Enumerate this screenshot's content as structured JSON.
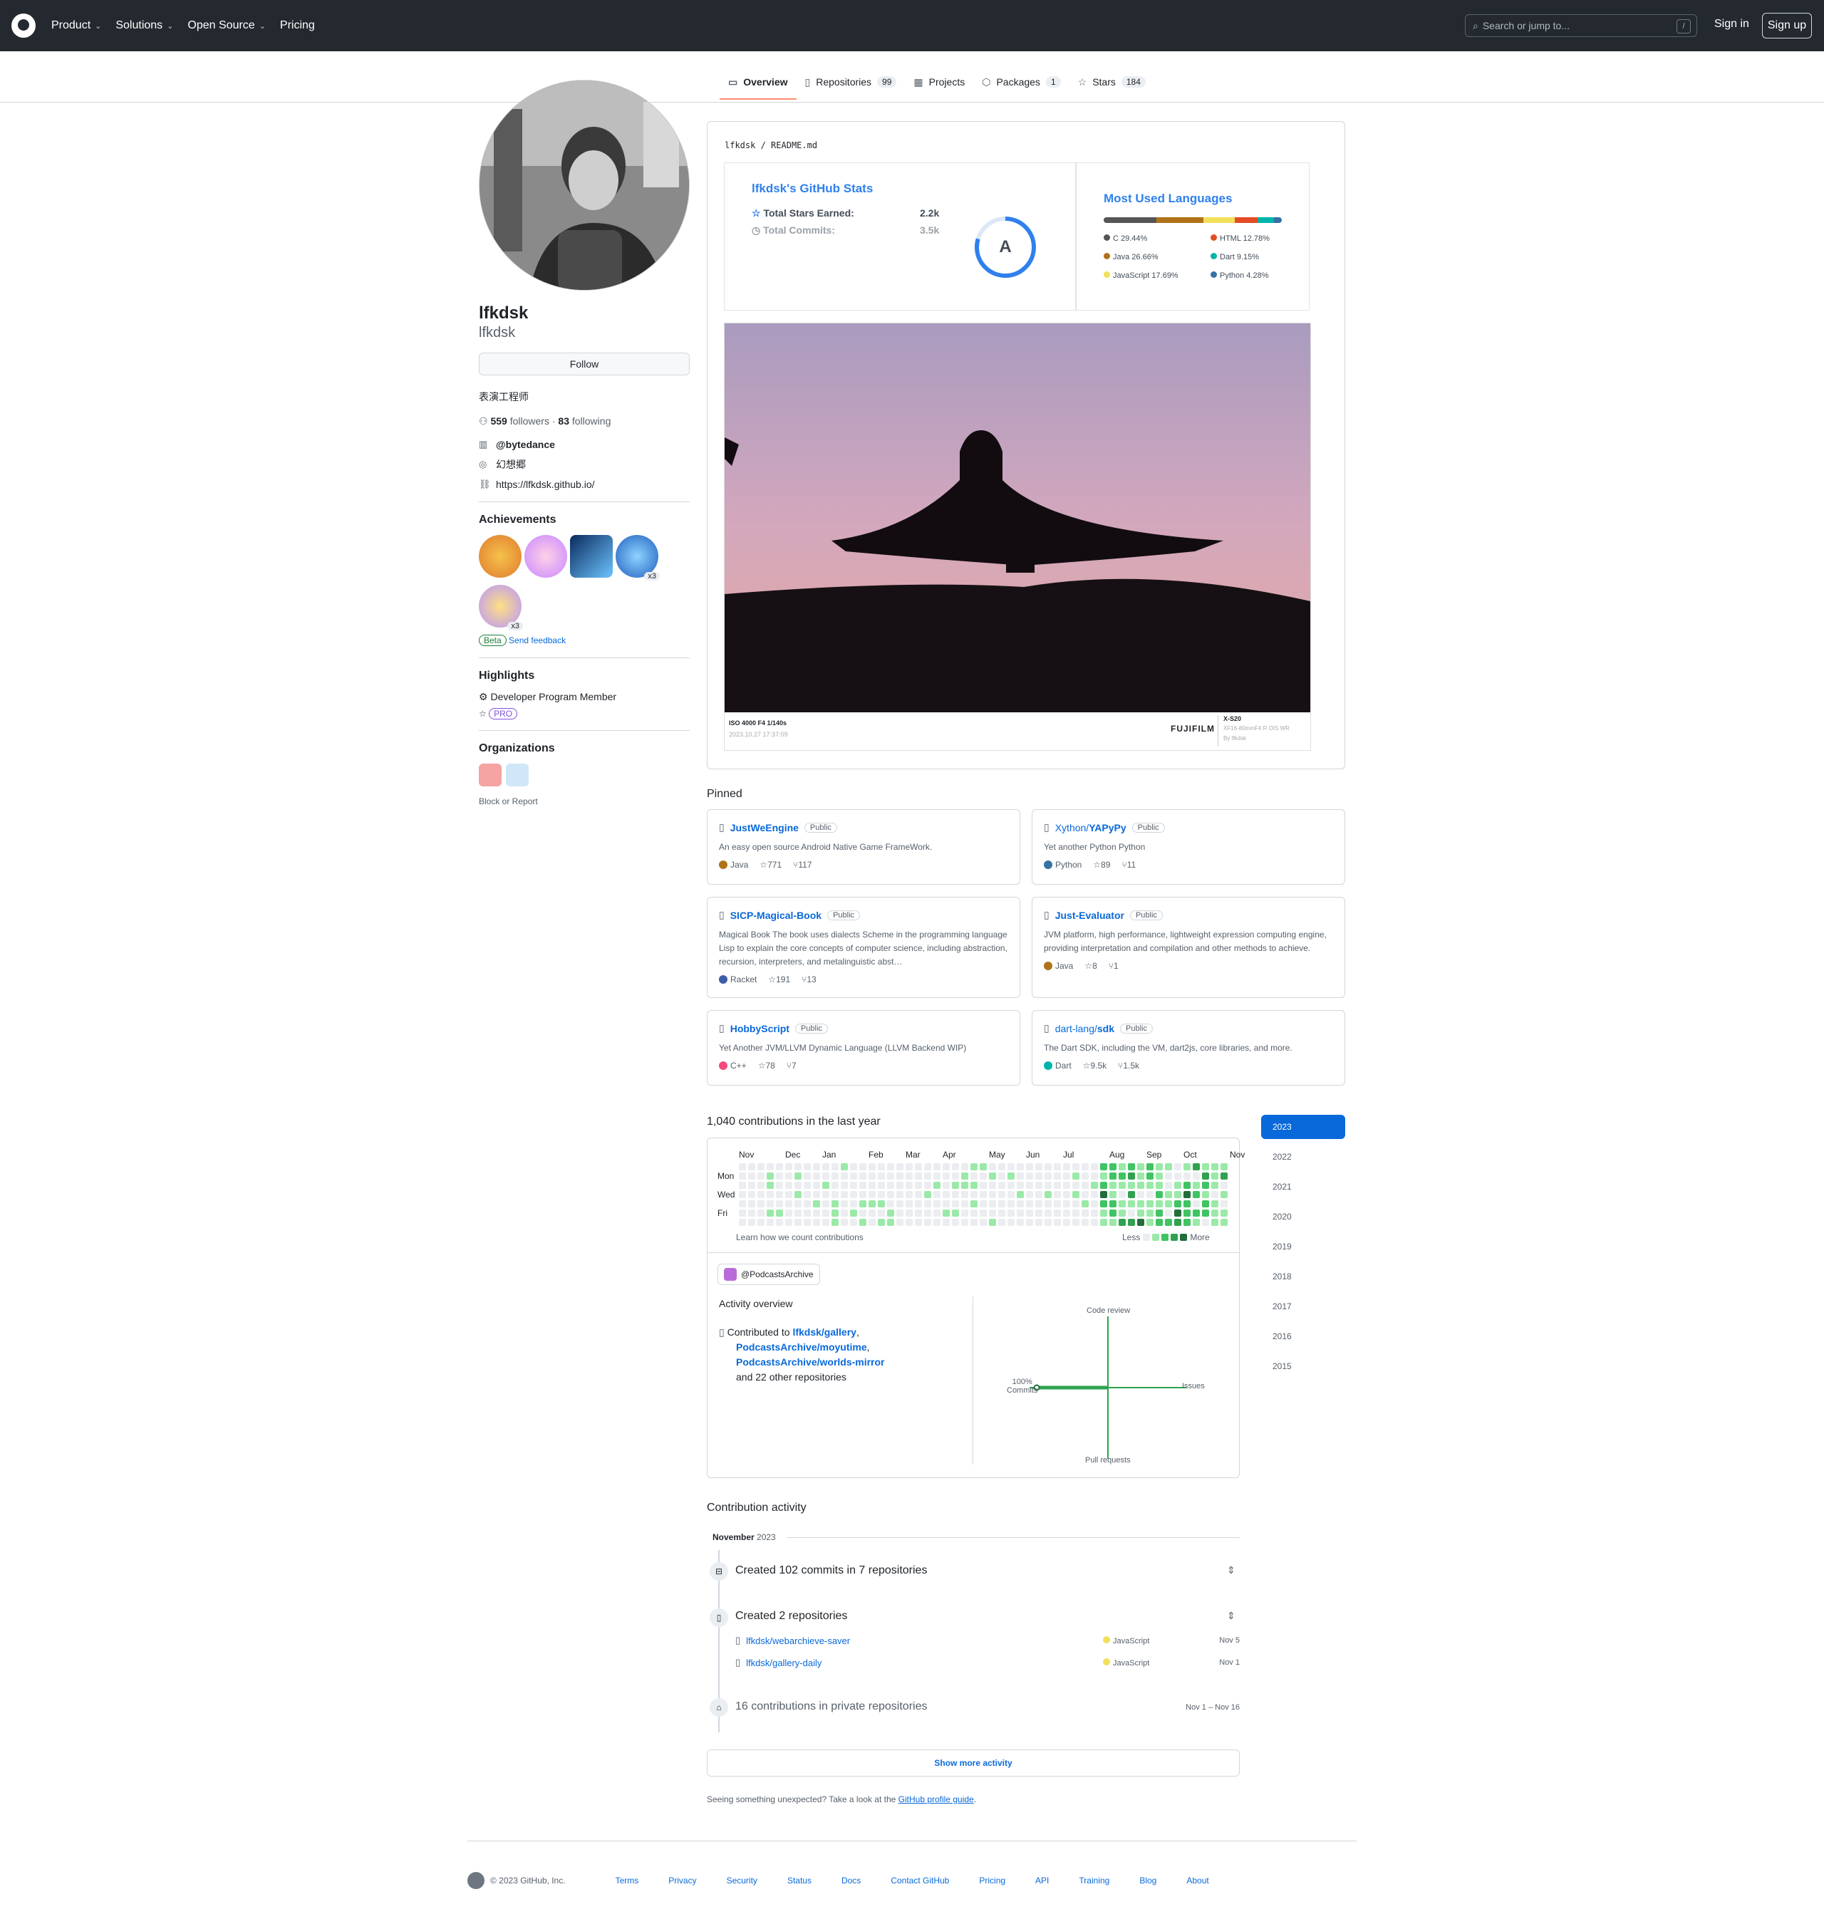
{
  "header": {
    "nav": [
      "Product",
      "Solutions",
      "Open Source",
      "Pricing"
    ],
    "search_placeholder": "Search or jump to...",
    "slash": "/",
    "signin": "Sign in",
    "signup": "Sign up"
  },
  "tabs": [
    {
      "label": "Overview",
      "icon": "book-icon"
    },
    {
      "label": "Repositories",
      "count": "99",
      "icon": "repo-icon"
    },
    {
      "label": "Projects",
      "icon": "table-icon"
    },
    {
      "label": "Packages",
      "count": "1",
      "icon": "package-icon"
    },
    {
      "label": "Stars",
      "count": "184",
      "icon": "star-icon"
    }
  ],
  "profile": {
    "fullname": "lfkdsk",
    "username": "lfkdsk",
    "follow": "Follow",
    "bio": "表演工程师",
    "followers": "559",
    "followers_label": "followers",
    "following": "83",
    "following_label": "following",
    "org": "@bytedance",
    "location": "幻想郷",
    "website": "https://lfkdsk.github.io/"
  },
  "achievements": {
    "title": "Achievements",
    "x3a": "x3",
    "x3b": "x3",
    "beta": "Beta",
    "feedback": "Send feedback"
  },
  "highlights": {
    "title": "Highlights",
    "item": "Developer Program Member",
    "pro": "PRO"
  },
  "orgs": {
    "title": "Organizations",
    "block": "Block or Report"
  },
  "readme": {
    "path_user": "lfkdsk",
    "path_file": "README.md"
  },
  "stats": {
    "title": "lfkdsk's GitHub Stats",
    "stars_label": "Total Stars Earned:",
    "stars": "2.2k",
    "commits_label": "Total Commits:",
    "commits": "3.5k",
    "grade": "A"
  },
  "langs": {
    "title": "Most Used Languages",
    "items": [
      {
        "name": "C 29.44%",
        "color": "#555555"
      },
      {
        "name": "HTML 12.78%",
        "color": "#e34c26"
      },
      {
        "name": "Java 26.66%",
        "color": "#b07219"
      },
      {
        "name": "Dart 9.15%",
        "color": "#00B4AB"
      },
      {
        "name": "JavaScript 17.69%",
        "color": "#f1e05a"
      },
      {
        "name": "Python 4.28%",
        "color": "#3572A5"
      }
    ]
  },
  "photo": {
    "exif": "ISO 4000 F4 1/140s",
    "date": "2023.10.27 17:37:09",
    "brand": "FUJIFILM",
    "model": "X-S20",
    "lens": "XF16-80mmF4 R OIS WR",
    "by": "By lfkdsk"
  },
  "pinned": {
    "title": "Pinned",
    "repos": [
      {
        "owner": "",
        "name": "JustWeEngine",
        "pub": "Public",
        "desc": "An easy open source Android Native Game FrameWork.",
        "lang": "Java",
        "color": "#b07219",
        "stars": "771",
        "forks": "117"
      },
      {
        "owner": "Xython/",
        "name": "YAPyPy",
        "pub": "Public",
        "desc": "Yet another Python Python",
        "lang": "Python",
        "color": "#3572A5",
        "stars": "89",
        "forks": "11"
      },
      {
        "owner": "",
        "name": "SICP-Magical-Book",
        "pub": "Public",
        "desc": "Magical Book The book uses dialects Scheme in the programming language Lisp to explain the core concepts of computer science, including abstraction, recursion, interpreters, and metalinguistic abst…",
        "lang": "Racket",
        "color": "#3c5caa",
        "stars": "191",
        "forks": "13"
      },
      {
        "owner": "",
        "name": "Just-Evaluator",
        "pub": "Public",
        "desc": "JVM platform, high performance, lightweight expression computing engine, providing interpretation and compilation and other methods to achieve.",
        "lang": "Java",
        "color": "#b07219",
        "stars": "8",
        "forks": "1"
      },
      {
        "owner": "",
        "name": "HobbyScript",
        "pub": "Public",
        "desc": "Yet Another JVM/LLVM Dynamic Language (LLVM Backend WIP)",
        "lang": "C++",
        "color": "#f34b7d",
        "stars": "78",
        "forks": "7"
      },
      {
        "owner": "dart-lang/",
        "name": "sdk",
        "pub": "Public",
        "desc": "The Dart SDK, including the VM, dart2js, core libraries, and more.",
        "lang": "Dart",
        "color": "#00B4AB",
        "stars": "9.5k",
        "forks": "1.5k"
      }
    ]
  },
  "contrib": {
    "title": "1,040 contributions in the last year",
    "months": [
      "Nov",
      "Dec",
      "Jan",
      "Feb",
      "Mar",
      "Apr",
      "May",
      "Jun",
      "Jul",
      "Aug",
      "Sep",
      "Oct",
      "Nov"
    ],
    "days": [
      "Mon",
      "Wed",
      "Fri"
    ],
    "learn": "Learn how we count contributions",
    "less": "Less",
    "more": "More",
    "org": "@PodcastsArchive",
    "overview": "Activity overview",
    "contributed": "Contributed to",
    "repos": [
      "lfkdsk/gallery",
      "PodcastsArchive/moyutime",
      "PodcastsArchive/worlds-mirror"
    ],
    "other": "and 22 other repositories",
    "axis": {
      "top": "Code review",
      "right": "Issues",
      "bottom": "Pull requests",
      "left_pct": "100%",
      "left": "Commits"
    }
  },
  "years": [
    "2023",
    "2022",
    "2021",
    "2020",
    "2019",
    "2018",
    "2017",
    "2016",
    "2015"
  ],
  "activity": {
    "title": "Contribution activity",
    "month": "November",
    "year": "2023",
    "commits": "Created 102 commits in 7 repositories",
    "created": "Created 2 repositories",
    "repos": [
      {
        "name": "lfkdsk/webarchieve-saver",
        "lang": "JavaScript",
        "date": "Nov 5"
      },
      {
        "name": "lfkdsk/gallery-daily",
        "lang": "JavaScript",
        "date": "Nov 1"
      }
    ],
    "private": "16 contributions in private repositories",
    "private_date": "Nov 1 – Nov 16",
    "showmore": "Show more activity",
    "unexpected": "Seeing something unexpected? Take a look at the",
    "guide": "GitHub profile guide",
    "dot": "."
  },
  "footer": {
    "copy": "© 2023 GitHub, Inc.",
    "links": [
      "Terms",
      "Privacy",
      "Security",
      "Status",
      "Docs",
      "Contact GitHub",
      "Pricing",
      "API",
      "Training",
      "Blog",
      "About"
    ]
  }
}
